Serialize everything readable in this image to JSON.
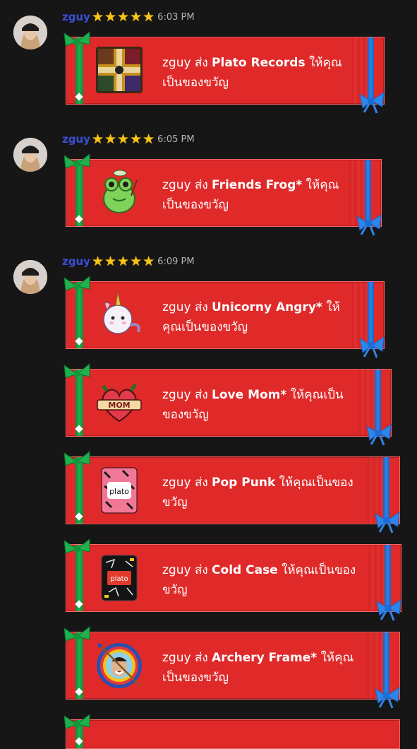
{
  "colors": {
    "background": "#161616",
    "username": "#3b4fd6",
    "card": "#e02a2a",
    "ribbon_green": "#1fb14d",
    "ribbon_blue": "#2e86e8",
    "star": "#f5c518"
  },
  "messages": [
    {
      "username": "zguy",
      "stars": [
        "★",
        "★",
        "★",
        "★",
        "★"
      ],
      "time": "6:03 PM",
      "gifts": [
        {
          "thumb_icon": "plato-records-board-icon",
          "sender": "zguy ส่ง ",
          "item": "Plato Records",
          "suffix": " ให้คุณเป็นของขวัญ"
        }
      ]
    },
    {
      "username": "zguy",
      "stars": [
        "★",
        "★",
        "★",
        "★",
        "★"
      ],
      "time": "6:05 PM",
      "gifts": [
        {
          "thumb_icon": "frog-sticker-icon",
          "sender": "zguy ส่ง ",
          "item": "Friends Frog*",
          "suffix": " ให้คุณเป็นของขวัญ"
        }
      ]
    },
    {
      "username": "zguy",
      "stars": [
        "★",
        "★",
        "★",
        "★",
        "★"
      ],
      "time": "6:09 PM",
      "gifts": [
        {
          "thumb_icon": "unicorn-sticker-icon",
          "sender": "zguy ส่ง ",
          "item": "Unicorny Angry*",
          "suffix": " ให้คุณเป็นของขวัญ"
        },
        {
          "thumb_icon": "love-mom-heart-icon",
          "sender": "zguy ส่ง ",
          "item": "Love Mom*",
          "suffix": " ให้คุณเป็นของขวัญ",
          "thumb_text": "MOM"
        },
        {
          "thumb_icon": "pop-punk-card-icon",
          "sender": "zguy ส่ง ",
          "item": "Pop Punk",
          "suffix": " ให้คุณเป็นของขวัญ",
          "thumb_text": "plato"
        },
        {
          "thumb_icon": "cold-case-card-icon",
          "sender": "zguy ส่ง ",
          "item": "Cold Case",
          "suffix": " ให้คุณเป็นของขวัญ",
          "thumb_text": "plato"
        },
        {
          "thumb_icon": "archery-frame-icon",
          "sender": "zguy ส่ง ",
          "item": "Archery Frame*",
          "suffix": " ให้คุณเป็นของขวัญ"
        }
      ]
    }
  ]
}
